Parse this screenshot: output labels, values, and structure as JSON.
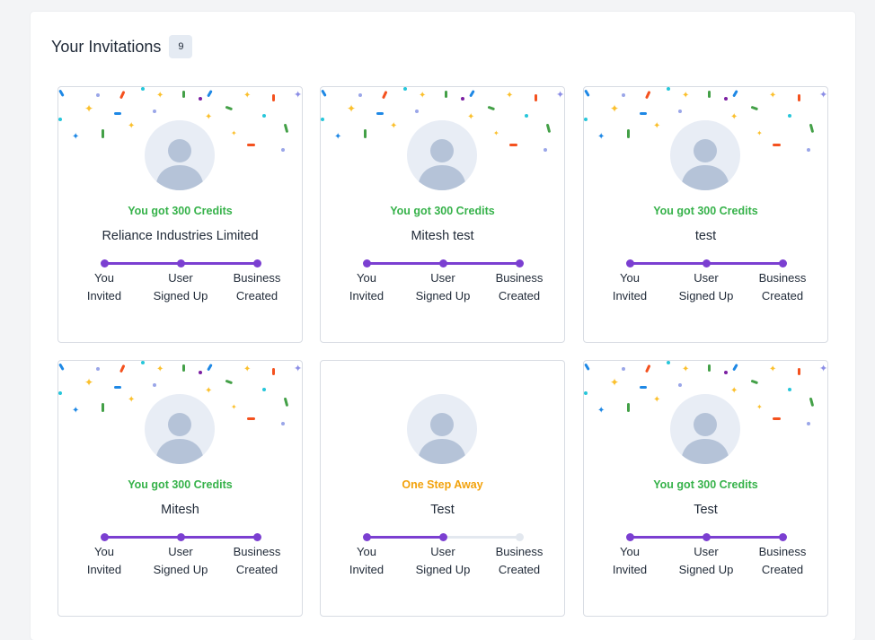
{
  "header": {
    "title": "Your Invitations",
    "count": "9"
  },
  "colors": {
    "progress_done": "#7b3fd1",
    "progress_todo": "#e3e8ef",
    "success_text": "#36b24a",
    "pending_text": "#f2a20c"
  },
  "steps": [
    {
      "line1": "You",
      "line2": "Invited"
    },
    {
      "line1": "User",
      "line2": "Signed Up"
    },
    {
      "line1": "Business",
      "line2": "Created"
    }
  ],
  "cards": [
    {
      "name": "Reliance Industries Limited",
      "status": "You got 300 Credits",
      "status_type": "success",
      "completed_steps": 3,
      "confetti": true
    },
    {
      "name": "Mitesh test",
      "status": "You got 300 Credits",
      "status_type": "success",
      "completed_steps": 3,
      "confetti": true
    },
    {
      "name": "test",
      "status": "You got 300 Credits",
      "status_type": "success",
      "completed_steps": 3,
      "confetti": true
    },
    {
      "name": "Mitesh",
      "status": "You got 300 Credits",
      "status_type": "success",
      "completed_steps": 3,
      "confetti": true
    },
    {
      "name": "Test",
      "status": "One Step Away",
      "status_type": "pending",
      "completed_steps": 2,
      "confetti": false
    },
    {
      "name": "Test",
      "status": "You got 300 Credits",
      "status_type": "success",
      "completed_steps": 3,
      "confetti": true
    }
  ],
  "icons": {
    "avatar": "user-avatar-icon",
    "confetti": "confetti-decoration"
  }
}
